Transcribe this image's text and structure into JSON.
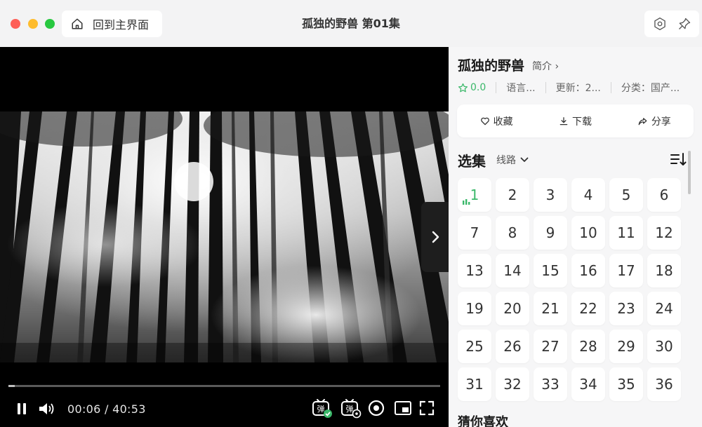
{
  "window": {
    "title": "孤独的野兽 第01集",
    "home_label": "回到主界面"
  },
  "player": {
    "current_time": "00:06",
    "time_sep": "/",
    "duration": "40:53",
    "progress": 0.014
  },
  "show": {
    "title": "孤独的野兽",
    "intro_link": "简介 ›",
    "rating": "0.0",
    "language": "语言...",
    "update": "更新：2...",
    "category": "分类：国产..."
  },
  "actions": {
    "favorite": "收藏",
    "download": "下载",
    "share": "分享"
  },
  "episodes": {
    "heading": "选集",
    "route_label": "线路",
    "active": "1",
    "items": [
      "1",
      "2",
      "3",
      "4",
      "5",
      "6",
      "7",
      "8",
      "9",
      "10",
      "11",
      "12",
      "13",
      "14",
      "15",
      "16",
      "17",
      "18",
      "19",
      "20",
      "21",
      "22",
      "23",
      "24",
      "25",
      "26",
      "27",
      "28",
      "29",
      "30",
      "31",
      "32",
      "33",
      "34",
      "35",
      "36"
    ]
  },
  "recommend": {
    "heading": "猜你喜欢"
  },
  "colors": {
    "accent": "#3bb86a",
    "panel_bg": "#f6f6f7",
    "titlebar_bg": "#f3f3f4"
  },
  "icons": {
    "home": "home-icon",
    "settings": "settings-icon",
    "pin": "pin-icon",
    "next": "chevron-right-icon",
    "pause": "pause-icon",
    "volume": "volume-icon",
    "danmaku_on": "danmaku-on-icon",
    "danmaku_settings": "danmaku-settings-icon",
    "record": "record-icon",
    "pip": "picture-in-picture-icon",
    "fullscreen": "fullscreen-icon",
    "sort": "sort-icon"
  }
}
